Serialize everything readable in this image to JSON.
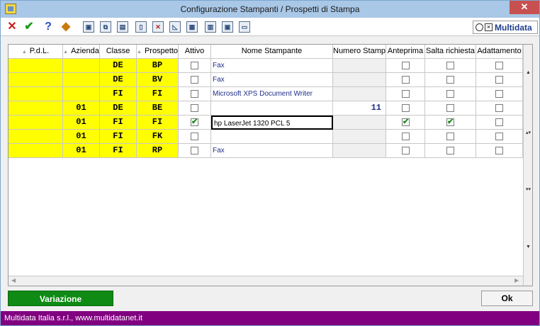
{
  "window": {
    "title": "Configurazione Stampanti / Prospetti di Stampa",
    "close_glyph": "✕"
  },
  "toolbar": {
    "icons": [
      "close-x-icon",
      "confirm-check-icon",
      "help-icon",
      "edit-icon",
      "binoculars-icon",
      "copy-icon",
      "paste-icon",
      "new-doc-icon",
      "delete-icon",
      "ruler-icon",
      "layout-icon",
      "filter-icon",
      "search-binoculars-icon",
      "monitor-icon"
    ],
    "colors": {
      "close": "#cc2020",
      "check": "#1a9a1a",
      "help": "#2a4fbf"
    }
  },
  "logo": {
    "text": "Multidata",
    "color": "#1f3e8a"
  },
  "grid": {
    "columns": [
      "P.d.L.",
      "Azienda",
      "Classe",
      "Prospetto",
      "Attivo",
      "Nome Stampante",
      "Numero Stampa",
      "Anteprima",
      "Salta richiesta",
      "Adattamento"
    ],
    "rows": [
      {
        "pdl": "",
        "azienda": "",
        "classe": "DE",
        "prospetto": "BP",
        "attivo": false,
        "stampante": "Fax",
        "numero": "",
        "anteprima": false,
        "salta": false,
        "adattamento": false
      },
      {
        "pdl": "",
        "azienda": "",
        "classe": "DE",
        "prospetto": "BV",
        "attivo": false,
        "stampante": "Fax",
        "numero": "",
        "anteprima": false,
        "salta": false,
        "adattamento": false
      },
      {
        "pdl": "",
        "azienda": "",
        "classe": "FI",
        "prospetto": "FI",
        "attivo": false,
        "stampante": "Microsoft XPS Document Writer",
        "numero": "",
        "anteprima": false,
        "salta": false,
        "adattamento": false
      },
      {
        "pdl": "",
        "azienda": "01",
        "classe": "DE",
        "prospetto": "BE",
        "attivo": false,
        "stampante": "",
        "numero": "11",
        "anteprima": false,
        "salta": false,
        "adattamento": false
      },
      {
        "pdl": "",
        "azienda": "01",
        "classe": "FI",
        "prospetto": "FI",
        "attivo": true,
        "stampante": "hp LaserJet 1320 PCL 5",
        "numero": "",
        "anteprima": true,
        "salta": true,
        "adattamento": false
      },
      {
        "pdl": "",
        "azienda": "01",
        "classe": "FI",
        "prospetto": "FK",
        "attivo": false,
        "stampante": "",
        "numero": "",
        "anteprima": false,
        "salta": false,
        "adattamento": false
      },
      {
        "pdl": "",
        "azienda": "01",
        "classe": "FI",
        "prospetto": "RP",
        "attivo": false,
        "stampante": "Fax",
        "numero": "",
        "anteprima": false,
        "salta": false,
        "adattamento": false
      }
    ],
    "key_color": "#ffff00"
  },
  "buttons": {
    "variazione": "Variazione",
    "ok": "Ok"
  },
  "status": {
    "text": "Multidata Italia s.r.l., www.multidatanet.it",
    "color": "#800080"
  }
}
